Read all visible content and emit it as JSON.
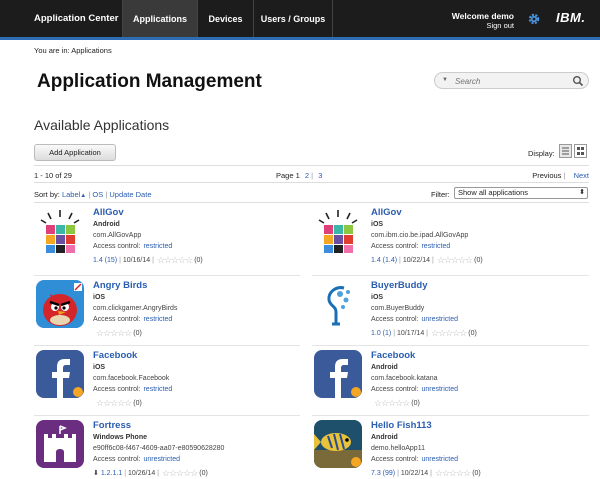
{
  "nav": {
    "brand": "Application Center",
    "tabs": [
      "Applications",
      "Devices",
      "Users / Groups"
    ],
    "welcome": "Welcome demo",
    "sign_out": "Sign out",
    "logo": "IBM.",
    "settings_icon": "gear-icon"
  },
  "breadcrumb": "You are in: Applications",
  "page_title": "Application Management",
  "search": {
    "placeholder": "Search"
  },
  "section_title": "Available Applications",
  "add_button": "Add Application",
  "display_label": "Display:",
  "pagination": {
    "count": "1 - 10 of 29",
    "page_label": "Page 1",
    "pages": [
      "2",
      "3"
    ],
    "previous": "Previous",
    "next": "Next"
  },
  "sort": {
    "label": "Sort by:",
    "options": [
      "Label",
      "OS",
      "Update Date"
    ]
  },
  "filter": {
    "label": "Filter:",
    "selected": "Show all applications"
  },
  "access_label": "Access control:",
  "apps": [
    {
      "name": "AllGov",
      "platform": "Android",
      "package": "com.AllGovApp",
      "access": "restricted",
      "version": "1.4 (15)",
      "date": "10/16/14",
      "rating": "(0)",
      "icon": "allgov"
    },
    {
      "name": "AllGov",
      "platform": "iOS",
      "package": "com.ibm.cio.be.ipad.AllGovApp",
      "access": "restricted",
      "version": "1.4 (1.4)",
      "date": "10/22/14",
      "rating": "(0)",
      "icon": "allgov"
    },
    {
      "name": "Angry Birds",
      "platform": "iOS",
      "package": "com.clickgamer.AngryBirds",
      "access": "restricted",
      "version": "",
      "date": "",
      "rating": "(0)",
      "icon": "angrybirds"
    },
    {
      "name": "BuyerBuddy",
      "platform": "iOS",
      "package": "com.BuyerBuddy",
      "access": "unrestricted",
      "version": "1.0 (1)",
      "date": "10/17/14",
      "rating": "(0)",
      "icon": "buyerbuddy"
    },
    {
      "name": "Facebook",
      "platform": "iOS",
      "package": "com.facebook.Facebook",
      "access": "restricted",
      "version": "",
      "date": "",
      "rating": "(0)",
      "icon": "facebook"
    },
    {
      "name": "Facebook",
      "platform": "Android",
      "package": "com.facebook.katana",
      "access": "unrestricted",
      "version": "",
      "date": "",
      "rating": "(0)",
      "icon": "facebook"
    },
    {
      "name": "Fortress",
      "platform": "Windows Phone",
      "package": "e90ff6c08-f467-4609-aa07-e80590628280",
      "access": "unrestricted",
      "version": "1.2.1.1",
      "date": "10/26/14",
      "rating": "(0)",
      "icon": "fortress"
    },
    {
      "name": "Hello Fish113",
      "platform": "Android",
      "package": "demo.helloApp11",
      "access": "unrestricted",
      "version": "7.3 (99)",
      "date": "10/22/14",
      "rating": "(0)",
      "icon": "fish"
    }
  ],
  "stars": "☆☆☆☆☆",
  "colors": {
    "nav_bg": "#1c1c1c",
    "accent": "#2f6db3",
    "link": "#2a5db0"
  }
}
